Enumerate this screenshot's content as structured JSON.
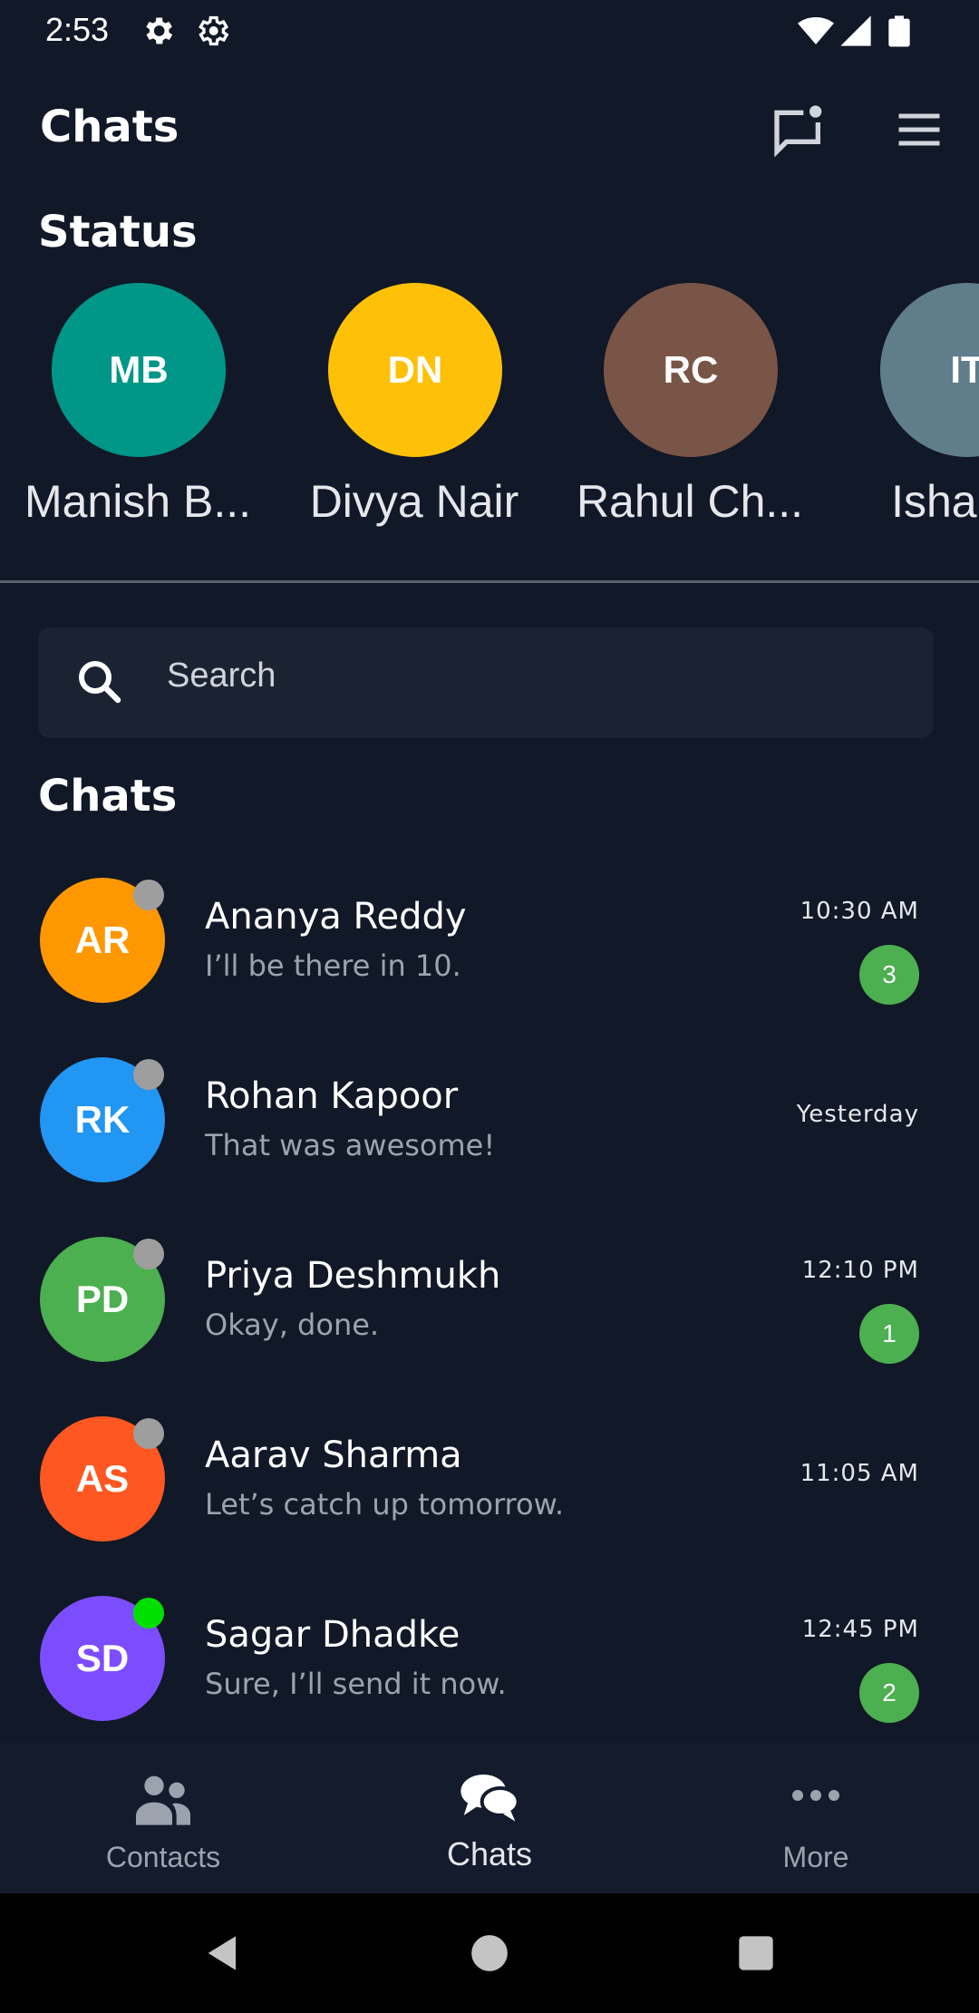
{
  "status_bar": {
    "time": "2:53",
    "icons": [
      "settings-icon",
      "gear-icon",
      "wifi-icon",
      "signal-icon",
      "battery-icon"
    ]
  },
  "app_bar": {
    "title": "Chats",
    "actions": [
      "new-chat-icon",
      "menu-icon"
    ]
  },
  "status_section": {
    "title": "Status",
    "items": [
      {
        "initials": "MB",
        "name": "Manish B...",
        "color": "#009688"
      },
      {
        "initials": "DN",
        "name": "Divya Nair",
        "color": "#ffc107"
      },
      {
        "initials": "RC",
        "name": "Rahul Ch...",
        "color": "#795548"
      },
      {
        "initials": "IT",
        "name": "Isha Th",
        "color": "#607d8b"
      }
    ]
  },
  "search": {
    "placeholder": "Search"
  },
  "chats_section": {
    "title": "Chats",
    "items": [
      {
        "initials": "AR",
        "name": "Ananya Reddy",
        "message": "I’ll be there in 10.",
        "time": "10:30 AM",
        "unread": "3",
        "color": "#ff9800",
        "presence": "#9e9e9e"
      },
      {
        "initials": "RK",
        "name": "Rohan Kapoor",
        "message": "That was awesome!",
        "time": "Yesterday",
        "unread": "",
        "color": "#2196f3",
        "presence": "#9e9e9e"
      },
      {
        "initials": "PD",
        "name": "Priya Deshmukh",
        "message": "Okay, done.",
        "time": "12:10 PM",
        "unread": "1",
        "color": "#4caf50",
        "presence": "#9e9e9e"
      },
      {
        "initials": "AS",
        "name": "Aarav Sharma",
        "message": "Let’s catch up tomorrow.",
        "time": "11:05 AM",
        "unread": "",
        "color": "#ff5722",
        "presence": "#9e9e9e"
      },
      {
        "initials": "SD",
        "name": "Sagar Dhadke",
        "message": "Sure, I’ll send it now.",
        "time": "12:45 PM",
        "unread": "2",
        "color": "#7c4dff",
        "presence": "#00e000"
      }
    ]
  },
  "bottom_nav": {
    "items": [
      {
        "label": "Contacts",
        "icon": "contacts-icon",
        "active": false
      },
      {
        "label": "Chats",
        "icon": "chat-bubbles-icon",
        "active": true
      },
      {
        "label": "More",
        "icon": "more-dots-icon",
        "active": false
      }
    ]
  },
  "system_nav": [
    "back-icon",
    "home-icon",
    "recents-icon"
  ],
  "colors": {
    "background": "#111827",
    "badge": "#4caf50",
    "search_bg": "#1b2333"
  }
}
